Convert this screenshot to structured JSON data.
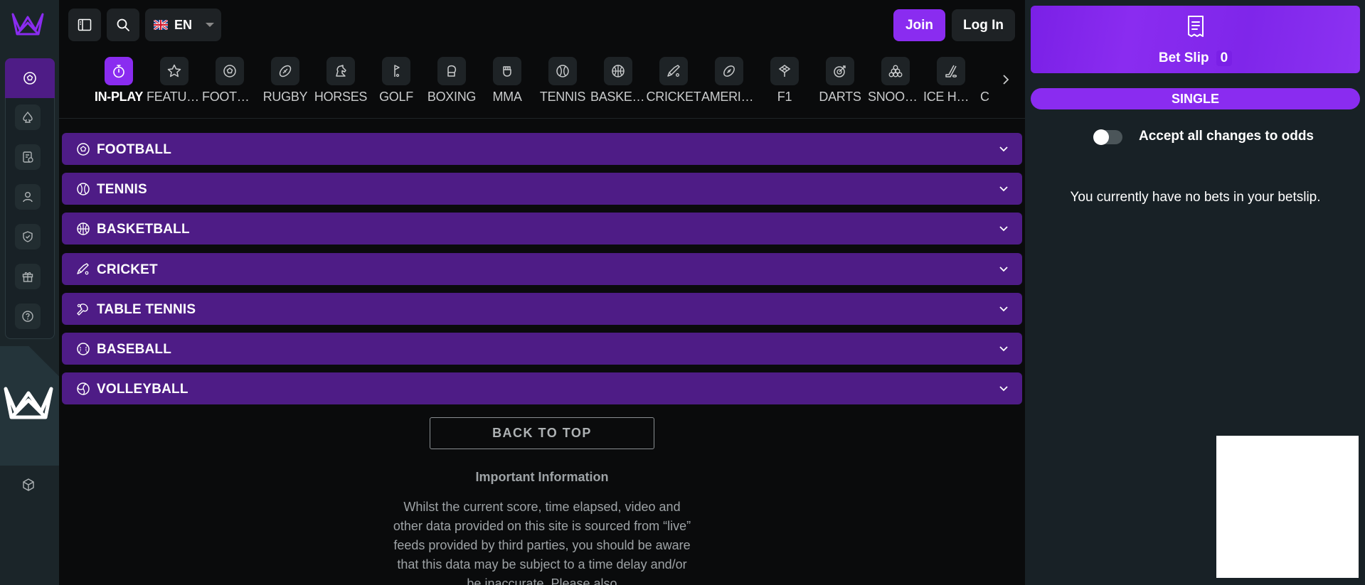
{
  "topbar": {
    "language": "EN",
    "join_label": "Join",
    "login_label": "Log In"
  },
  "sports": [
    {
      "label": "IN-PLAY",
      "icon": "stopwatch-icon",
      "active": true
    },
    {
      "label": "FEATURED",
      "icon": "star-icon"
    },
    {
      "label": "FOOTBALL",
      "icon": "football-icon"
    },
    {
      "label": "RUGBY",
      "icon": "rugby-ball-icon"
    },
    {
      "label": "HORSES",
      "icon": "horse-icon"
    },
    {
      "label": "GOLF",
      "icon": "golf-flag-icon"
    },
    {
      "label": "BOXING",
      "icon": "boxing-glove-icon"
    },
    {
      "label": "MMA",
      "icon": "fist-icon"
    },
    {
      "label": "TENNIS",
      "icon": "tennis-ball-icon"
    },
    {
      "label": "BASKETBALL",
      "icon": "basketball-icon"
    },
    {
      "label": "CRICKET",
      "icon": "cricket-bat-icon"
    },
    {
      "label": "AMERICAN FOOTBALL",
      "icon": "american-football-icon"
    },
    {
      "label": "F1",
      "icon": "checkered-flag-icon"
    },
    {
      "label": "DARTS",
      "icon": "dartboard-icon"
    },
    {
      "label": "SNOOKER",
      "icon": "snooker-balls-icon"
    },
    {
      "label": "ICE HOCKEY",
      "icon": "hockey-stick-icon"
    },
    {
      "label": "C",
      "icon": ""
    }
  ],
  "sections": [
    {
      "label": "FOOTBALL",
      "icon": "football-icon"
    },
    {
      "label": "TENNIS",
      "icon": "tennis-ball-icon"
    },
    {
      "label": "BASKETBALL",
      "icon": "basketball-icon"
    },
    {
      "label": "CRICKET",
      "icon": "cricket-bat-icon"
    },
    {
      "label": "TABLE TENNIS",
      "icon": "table-tennis-icon"
    },
    {
      "label": "BASEBALL",
      "icon": "baseball-icon"
    },
    {
      "label": "VOLLEYBALL",
      "icon": "volleyball-icon"
    }
  ],
  "main": {
    "back_to_top": "BACK TO TOP",
    "info_title": "Important Information",
    "info_body": "Whilst the current score, time elapsed, video and other data provided on this site is sourced from “live” feeds provided by third parties, you should be aware that this data may be subject to a time delay and/or be inaccurate. Please also"
  },
  "betslip": {
    "title": "Bet Slip",
    "count": "0",
    "tab_single": "SINGLE",
    "accept_label": "Accept all changes to odds",
    "empty_message": "You currently have no bets in your betslip."
  },
  "colors": {
    "accent": "#8a2cf0",
    "section_bg": "#4e1c86",
    "rail_bg": "#1b2529",
    "page_bg": "#0a0b0c"
  }
}
